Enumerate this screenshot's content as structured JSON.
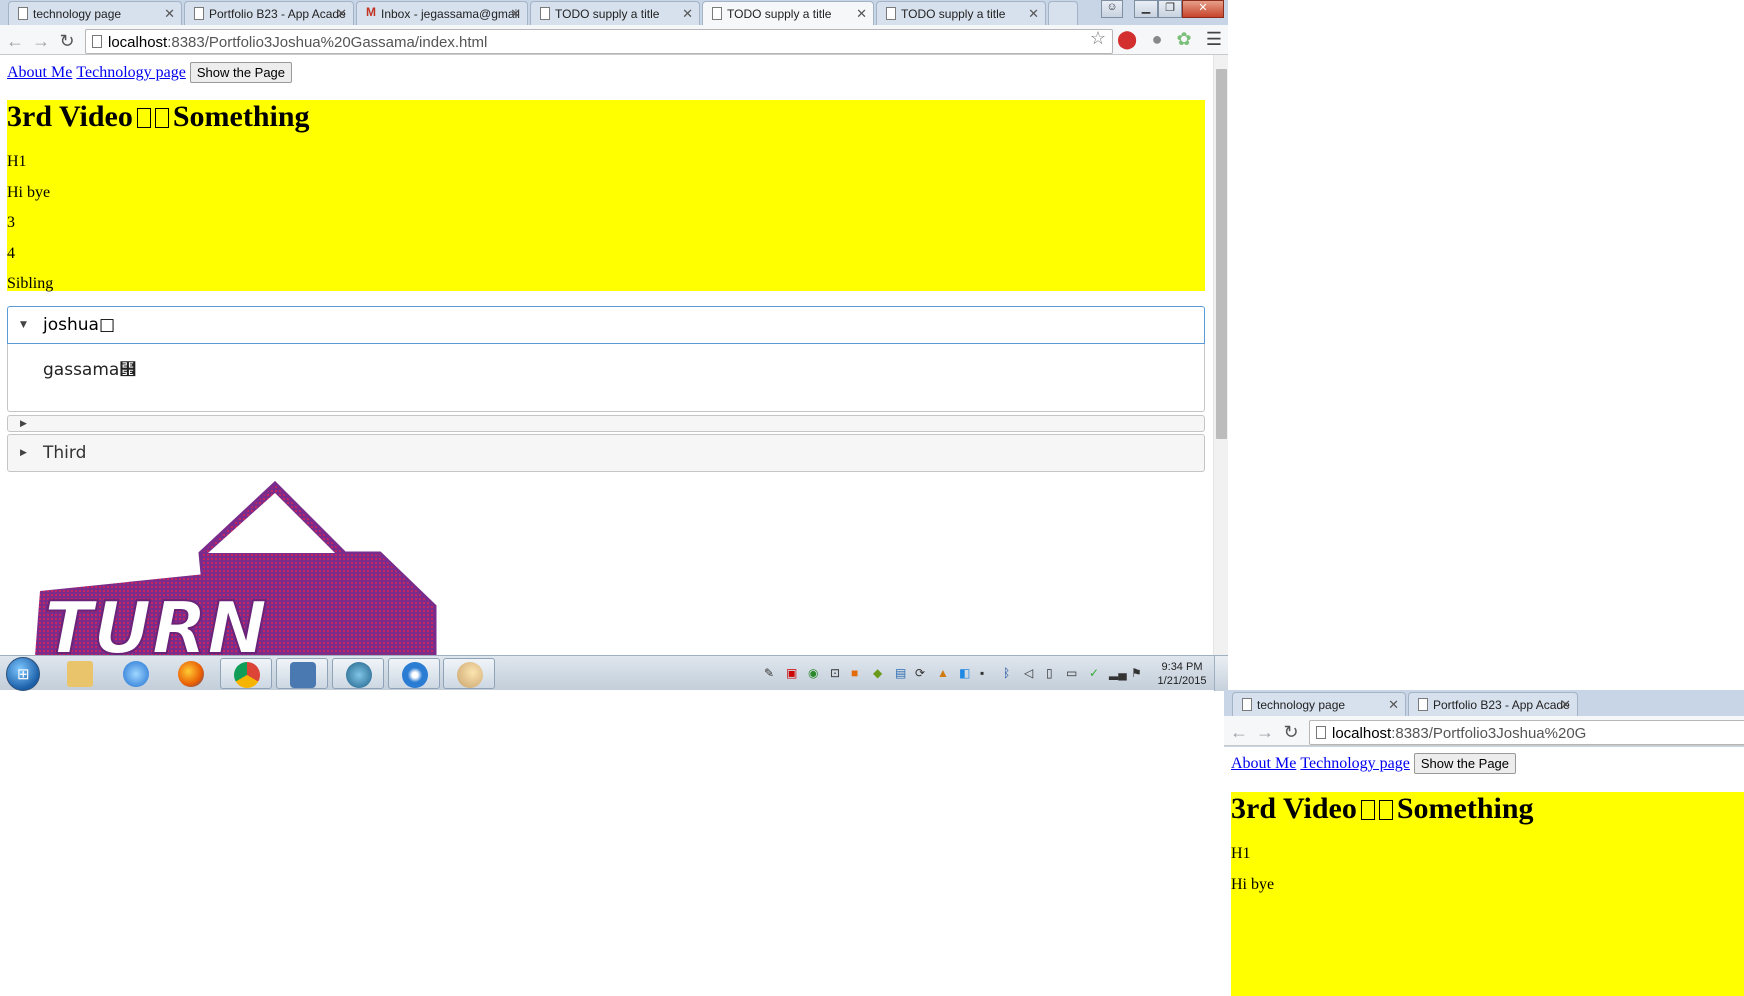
{
  "window": {
    "tabs": [
      {
        "title": "technology page",
        "icon": "page-icon"
      },
      {
        "title": "Portfolio B23 - App Acade",
        "icon": "page-icon"
      },
      {
        "title": "Inbox - jegassama@gmail",
        "icon": "gmail-icon"
      },
      {
        "title": "TODO supply a title",
        "icon": "page-icon"
      },
      {
        "title": "TODO supply a title",
        "icon": "page-icon",
        "active": true
      },
      {
        "title": "TODO supply a title",
        "icon": "page-icon"
      }
    ],
    "address": {
      "host": "localhost",
      "rest": ":8383/Portfolio3Joshua%20Gassama/index.html"
    }
  },
  "page": {
    "nav": {
      "about": "About Me",
      "technology": "Technology page",
      "button": "Show the Page"
    },
    "heading": {
      "left": "3rd Video",
      "right": "Something"
    },
    "paragraphs": [
      "H1",
      "Hi bye",
      "3",
      "4",
      "Sibling"
    ],
    "accordion": {
      "first_header": "joshua□",
      "first_panel": "gassama⹞",
      "second_header": "",
      "third_header": "Third"
    },
    "image_text": "TURN"
  },
  "taskbar": {
    "clock_time": "9:34 PM",
    "clock_date": "1/21/2015"
  },
  "window2": {
    "tabs": [
      {
        "title": "technology page"
      },
      {
        "title": "Portfolio B23 - App Acade"
      }
    ],
    "address": {
      "host": "localhost",
      "rest": ":8383/Portfolio3Joshua%20G"
    },
    "nav": {
      "about": "About Me",
      "technology": "Technology page",
      "button": "Show the Page"
    },
    "heading": {
      "left": "3rd Video",
      "right": "Something"
    },
    "paragraphs": [
      "H1",
      "Hi bye"
    ]
  }
}
